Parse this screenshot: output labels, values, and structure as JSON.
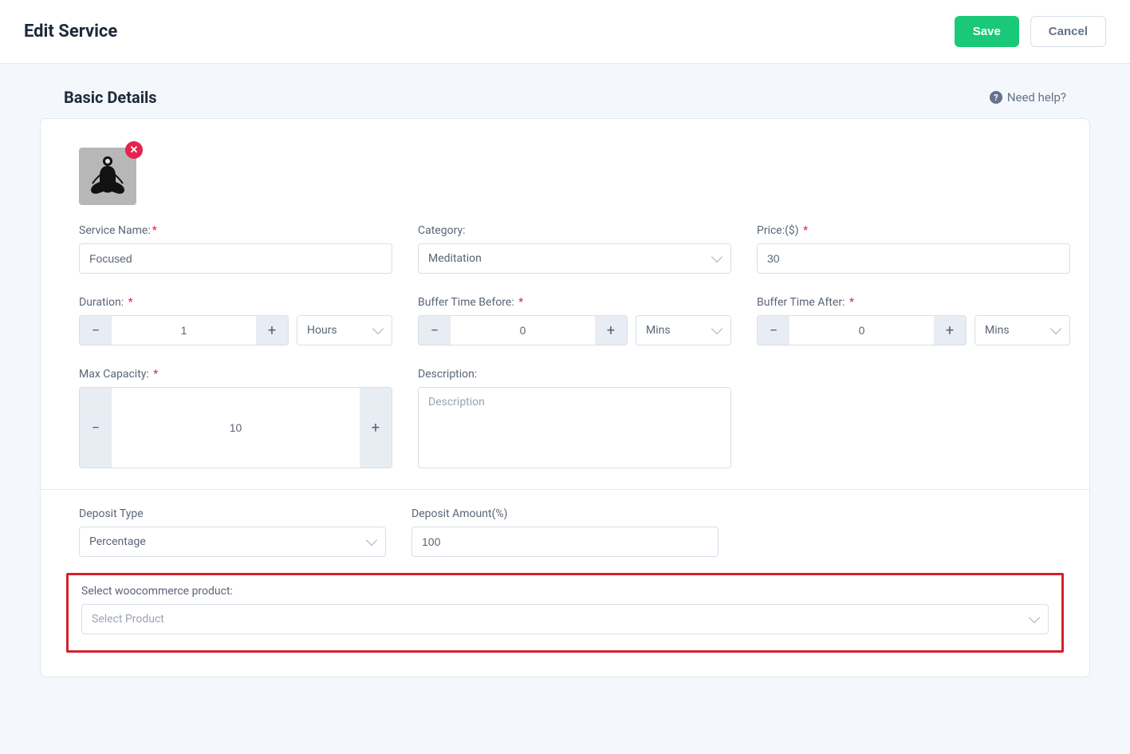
{
  "header": {
    "title": "Edit Service",
    "save_label": "Save",
    "cancel_label": "Cancel"
  },
  "section": {
    "title": "Basic Details",
    "need_help": "Need help?"
  },
  "form": {
    "service_name_label": "Service Name:",
    "service_name_value": "Focused",
    "category_label": "Category:",
    "category_value": "Meditation",
    "price_label": "Price:($)",
    "price_value": "30",
    "duration_label": "Duration:",
    "duration_value": "1",
    "duration_unit": "Hours",
    "buffer_before_label": "Buffer Time Before:",
    "buffer_before_value": "0",
    "buffer_before_unit": "Mins",
    "buffer_after_label": "Buffer Time After:",
    "buffer_after_value": "0",
    "buffer_after_unit": "Mins",
    "max_capacity_label": "Max Capacity:",
    "max_capacity_value": "10",
    "description_label": "Description:",
    "description_placeholder": "Description",
    "deposit_type_label": "Deposit Type",
    "deposit_type_value": "Percentage",
    "deposit_amount_label": "Deposit Amount(%)",
    "deposit_amount_value": "100",
    "woo_label": "Select woocommerce product:",
    "woo_placeholder": "Select Product"
  }
}
